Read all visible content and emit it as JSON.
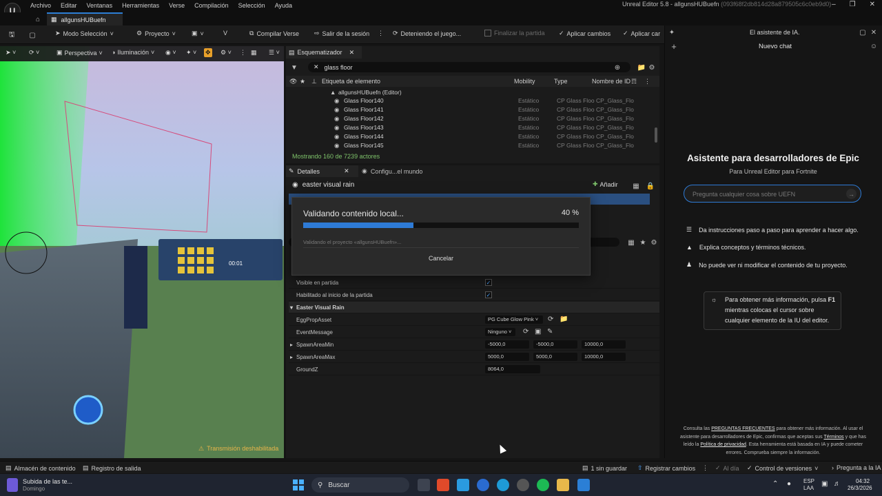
{
  "menubar": {
    "items": [
      "Archivo",
      "Editar",
      "Ventanas",
      "Herramientas",
      "Verse",
      "Compilación",
      "Selección",
      "Ayuda"
    ],
    "window_title": "Unreal Editor 5.8 - allgunsHUBuefn",
    "window_hash": "(093f68f2db814d28a879505c6c0eb9d0)"
  },
  "document_tab": {
    "label": "allgunsHUBuefn"
  },
  "toolbar": {
    "mode": "Modo Selección",
    "project": "Proyecto",
    "compile": "Compilar Verse",
    "exit_session": "Salir de la sesión",
    "stopping": "Deteniendo el juego...",
    "finish_match": "Finalizar la partida",
    "apply_changes": "Aplicar cambios",
    "apply_more": "Aplicar car"
  },
  "viewport": {
    "perspective": "Perspectiva",
    "lighting": "Iluminación",
    "warning": "Transmisión deshabilitada",
    "hud_readout": "00:01"
  },
  "outliner": {
    "tab": "Esquematizador",
    "search_value": "glass floor",
    "columns": [
      "Etiqueta de elemento",
      "Mobility",
      "Type",
      "Nombre de ID"
    ],
    "root": "allgunsHUBuefn (Editor)",
    "rows": [
      {
        "label": "Glass Floor140",
        "mobility": "Estático",
        "type": "CP Glass Floo",
        "id": "CP_Glass_Flo"
      },
      {
        "label": "Glass Floor141",
        "mobility": "Estático",
        "type": "CP Glass Floo",
        "id": "CP_Glass_Flo"
      },
      {
        "label": "Glass Floor142",
        "mobility": "Estático",
        "type": "CP Glass Floo",
        "id": "CP_Glass_Flo"
      },
      {
        "label": "Glass Floor143",
        "mobility": "Estático",
        "type": "CP Glass Floo",
        "id": "CP_Glass_Flo"
      },
      {
        "label": "Glass Floor144",
        "mobility": "Estático",
        "type": "CP Glass Floo",
        "id": "CP_Glass_Flo"
      },
      {
        "label": "Glass Floor145",
        "mobility": "Estático",
        "type": "CP Glass Floo",
        "id": "CP_Glass_Flo"
      }
    ],
    "count": "Mostrando 160 de 7239 actores"
  },
  "details": {
    "tab1": "Detalles",
    "tab2": "Configu...el mundo",
    "actor": "easter visual rain",
    "add_button": "Añadir",
    "props": {
      "visible_label": "Visible en partida",
      "enabled_label": "Habilitado al inicio de la partida",
      "section": "Easter Visual Rain",
      "egg_label": "EggPropAsset",
      "egg_value": "PG Cube Glow Pink",
      "event_label": "EventMessage",
      "event_value": "Ninguno",
      "min_label": "SpawnAreaMin",
      "min_x": "-5000,0",
      "min_y": "-5000,0",
      "min_z": "10000,0",
      "max_label": "SpawnAreaMax",
      "max_x": "5000,0",
      "max_y": "5000,0",
      "max_z": "10000,0",
      "ground_label": "GroundZ",
      "ground_value": "8064,0"
    }
  },
  "dialog": {
    "title": "Validando contenido local...",
    "percent_text": "40 %",
    "progress": 0.4,
    "subtitle": "Validando el proyecto «allgunsHUBuefn»...",
    "cancel": "Cancelar"
  },
  "ai_panel": {
    "title": "El asistente de IA.",
    "new_chat": "Nuevo chat",
    "heading": "Asistente para desarrolladores de Epic",
    "subheading": "Para Unreal Editor para Fortnite",
    "input_placeholder": "Pregunta cualquier cosa sobre UEFN",
    "features": [
      "Da instrucciones paso a paso para aprender a hacer algo.",
      "Explica conceptos y términos técnicos.",
      "No puede ver ni modificar el contenido de tu proyecto."
    ],
    "tip_part1": "Para obtener más información, pulsa ",
    "tip_key": "F1",
    "tip_part2": " mientras colocas el cursor sobre cualquier elemento de la IU del editor.",
    "footer_1": "Consulta las ",
    "footer_link1": "PREGUNTAS FRECUENTES",
    "footer_2": " para obtener más información. Al usar el asistente para desarrolladores de Epic, confirmas que aceptas sus ",
    "footer_link2": "Términos",
    "footer_3": " y que has leído la ",
    "footer_link3": "Política de privacidad",
    "footer_4": ". Esta herramienta está basada en IA y puede cometer errores. Comprueba siempre la información."
  },
  "statusbar": {
    "content_drawer": "Almacén de contenido",
    "output_log": "Registro de salida",
    "unsaved": "1 sin guardar",
    "register_changes": "Registrar cambios",
    "ai_day": "Al día",
    "version_control": "Control de versiones",
    "ask_ai": "Pregunta a la IA"
  },
  "taskbar": {
    "notify_title": "Subida de las te...",
    "notify_sub": "Domingo",
    "search": "Buscar",
    "lang_1": "ESP",
    "lang_2": "LAA",
    "time": "04:32",
    "date": "26/3/2026"
  },
  "colors": {
    "accent": "#2e7bd6",
    "warning": "#e8b54a",
    "count_green": "#7fc46b"
  }
}
